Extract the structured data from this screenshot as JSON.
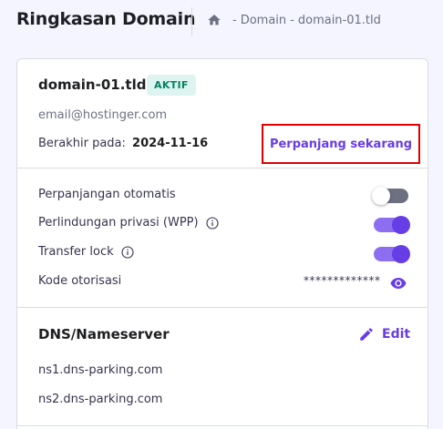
{
  "header": {
    "title": "Ringkasan Domain",
    "breadcrumb": {
      "home_icon": "home-icon",
      "items": [
        "Domain",
        "domain-01.tld"
      ],
      "separator": "-"
    }
  },
  "domain": {
    "name": "domain-01.tld",
    "status_badge": "AKTIF",
    "email": "email@hostinger.com",
    "expiry_label": "Berakhir pada:",
    "expiry_date": "2024-11-16",
    "renew_button": "Perpanjang sekarang"
  },
  "settings": [
    {
      "label": "Perpanjangan otomatis",
      "info": false,
      "enabled": false
    },
    {
      "label": "Perlindungan privasi (WPP)",
      "info": true,
      "enabled": true
    },
    {
      "label": "Transfer lock",
      "info": true,
      "enabled": true
    }
  ],
  "auth_code": {
    "label": "Kode otorisasi",
    "masked_value": "*************",
    "reveal_icon": "eye-icon"
  },
  "dns": {
    "title": "DNS/Nameserver",
    "edit_label": "Edit",
    "nameservers": [
      "ns1.dns-parking.com",
      "ns2.dns-parking.com"
    ]
  },
  "colors": {
    "accent": "#673de6",
    "badge_bg": "#def4f0",
    "badge_text": "#008361",
    "highlight_border": "#e00000",
    "toggle_off": "#6d7081"
  }
}
